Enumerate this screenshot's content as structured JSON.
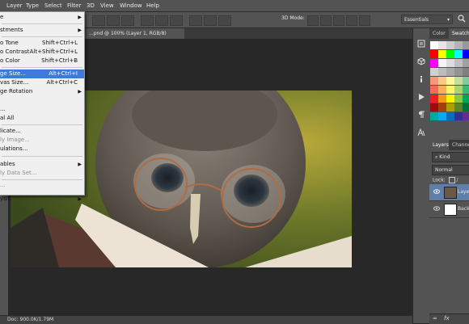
{
  "menubar": {
    "items": [
      "Layer",
      "Type",
      "Select",
      "Filter",
      "3D",
      "View",
      "Window",
      "Help"
    ]
  },
  "options_bar": {
    "mode_3d": "3D Mode:",
    "workspace": "Essentials"
  },
  "document_tab": {
    "label": "...pnd @ 100% (Layer 1, RGB/8)",
    "close": "×"
  },
  "status_bar": {
    "doc_size": "Doc: 900.0K/1.79M"
  },
  "image_menu": {
    "items": [
      {
        "label": "e",
        "shortcut": "",
        "submenu": true,
        "disabled": false,
        "highlighted": false
      },
      {
        "label": "stments",
        "shortcut": "",
        "submenu": true,
        "disabled": false,
        "highlighted": false
      },
      {
        "label": "o Tone",
        "shortcut": "Shift+Ctrl+L",
        "submenu": false,
        "disabled": false,
        "highlighted": false
      },
      {
        "label": "o Contrast",
        "shortcut": "Alt+Shift+Ctrl+L",
        "submenu": false,
        "disabled": false,
        "highlighted": false
      },
      {
        "label": "o Color",
        "shortcut": "Shift+Ctrl+B",
        "submenu": false,
        "disabled": false,
        "highlighted": false
      },
      {
        "label": "ge Size...",
        "shortcut": "Alt+Ctrl+I",
        "submenu": false,
        "disabled": false,
        "highlighted": true
      },
      {
        "label": "vas Size...",
        "shortcut": "Alt+Ctrl+C",
        "submenu": false,
        "disabled": false,
        "highlighted": false
      },
      {
        "label": "ge Rotation",
        "shortcut": "",
        "submenu": true,
        "disabled": false,
        "highlighted": false
      },
      {
        "label": "",
        "shortcut": "",
        "submenu": false,
        "disabled": false,
        "highlighted": false
      },
      {
        "label": "...",
        "shortcut": "",
        "submenu": false,
        "disabled": false,
        "highlighted": false
      },
      {
        "label": "al All",
        "shortcut": "",
        "submenu": false,
        "disabled": false,
        "highlighted": false
      },
      {
        "label": "licate...",
        "shortcut": "",
        "submenu": false,
        "disabled": false,
        "highlighted": false
      },
      {
        "label": "ly Image...",
        "shortcut": "",
        "submenu": false,
        "disabled": true,
        "highlighted": false
      },
      {
        "label": "ulations...",
        "shortcut": "",
        "submenu": false,
        "disabled": false,
        "highlighted": false
      },
      {
        "label": "ables",
        "shortcut": "",
        "submenu": true,
        "disabled": false,
        "highlighted": false
      },
      {
        "label": "ly Data Set...",
        "shortcut": "",
        "submenu": false,
        "disabled": true,
        "highlighted": false
      },
      {
        "label": "...",
        "shortcut": "",
        "submenu": false,
        "disabled": true,
        "highlighted": false
      },
      {
        "label": "ysis",
        "shortcut": "",
        "submenu": true,
        "disabled": false,
        "highlighted": false
      }
    ]
  },
  "right_panel": {
    "top_tabs": [
      "Color",
      "Swatches"
    ],
    "layers_tabs": [
      "Layers",
      "Channels"
    ],
    "kind_label": "Kind",
    "blend_mode": "Normal",
    "lock_label": "Lock:",
    "layers": [
      {
        "name": "Layer 1",
        "selected": true
      },
      {
        "name": "Background",
        "selected": false
      }
    ],
    "bottom_label": "fx"
  },
  "icons": [
    "search-icon",
    "history-icon",
    "3d-cube-icon",
    "info-icon",
    "play-icon",
    "paragraph-icon",
    "character-icon",
    "eye-icon",
    "lock-icon",
    "link-icon",
    "fx-icon"
  ]
}
